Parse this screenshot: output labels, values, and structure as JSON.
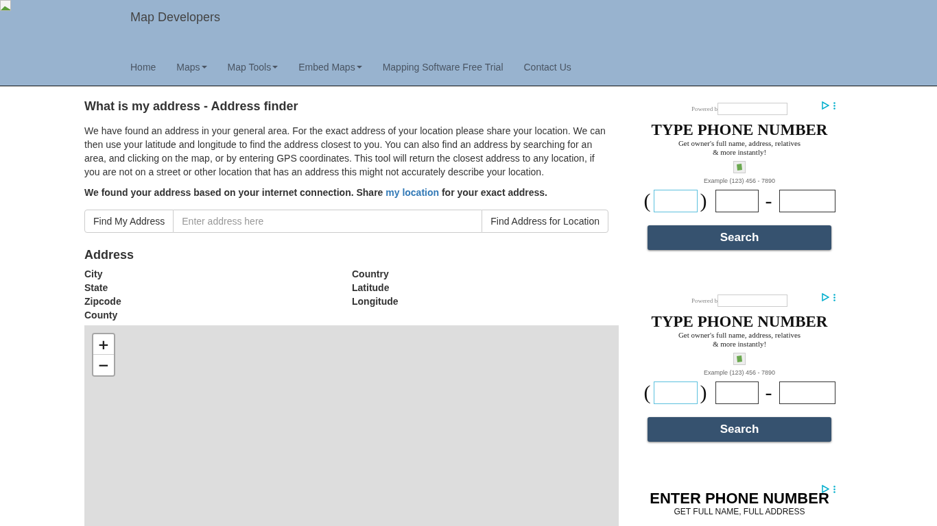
{
  "header": {
    "site_title": "Map Developers",
    "nav": [
      {
        "label": "Home",
        "dropdown": false
      },
      {
        "label": "Maps",
        "dropdown": true
      },
      {
        "label": "Map Tools",
        "dropdown": true
      },
      {
        "label": "Embed Maps",
        "dropdown": true
      },
      {
        "label": "Mapping Software Free Trial",
        "dropdown": false
      },
      {
        "label": "Contact Us",
        "dropdown": false
      }
    ]
  },
  "main": {
    "title": "What is my address - Address finder",
    "intro": "We have found an address in your general area. For the exact address of your location please share your location. We can then use your latitude and longitude to find the address closest to you. You can also find an address by searching for an area, and clicking on the map, or by entering GPS coordinates. This tool will return the closest address to any location, if you are not on a street or other location that has an address this might not accurately describe your location.",
    "notice": {
      "before": "We found your address based on your internet connection. Share ",
      "link": "my location",
      "after": " for your exact address."
    },
    "search": {
      "left_button": "Find My Address",
      "placeholder": "Enter address here",
      "right_button": "Find Address for Location"
    },
    "address": {
      "heading": "Address",
      "left_fields": [
        "City",
        "State",
        "Zipcode",
        "County"
      ],
      "right_fields": [
        "Country",
        "Latitude",
        "Longitude"
      ]
    },
    "map": {
      "zoom_in": "+",
      "zoom_out": "−"
    }
  },
  "ads": [
    {
      "kind": "phone_form",
      "powered_by": "Powered b",
      "headline": "TYPE PHONE NUMBER",
      "sublines": [
        "Get owner's full name, address, relatives",
        "& more instantly!"
      ],
      "example": "Example (123) 456 - 7890",
      "open_paren": "(",
      "close_paren": ")",
      "dash": "-",
      "button": "Search"
    },
    {
      "kind": "phone_form",
      "powered_by": "Powered b",
      "headline": "TYPE PHONE NUMBER",
      "sublines": [
        "Get owner's full name, address, relatives",
        "& more instantly!"
      ],
      "example": "Example (123) 456 - 7890",
      "open_paren": "(",
      "close_paren": ")",
      "dash": "-",
      "button": "Search"
    },
    {
      "kind": "phone_banner",
      "headline": "ENTER PHONE NUMBER",
      "sublines": [
        "GET FULL NAME, FULL ADDRESS"
      ]
    }
  ]
}
